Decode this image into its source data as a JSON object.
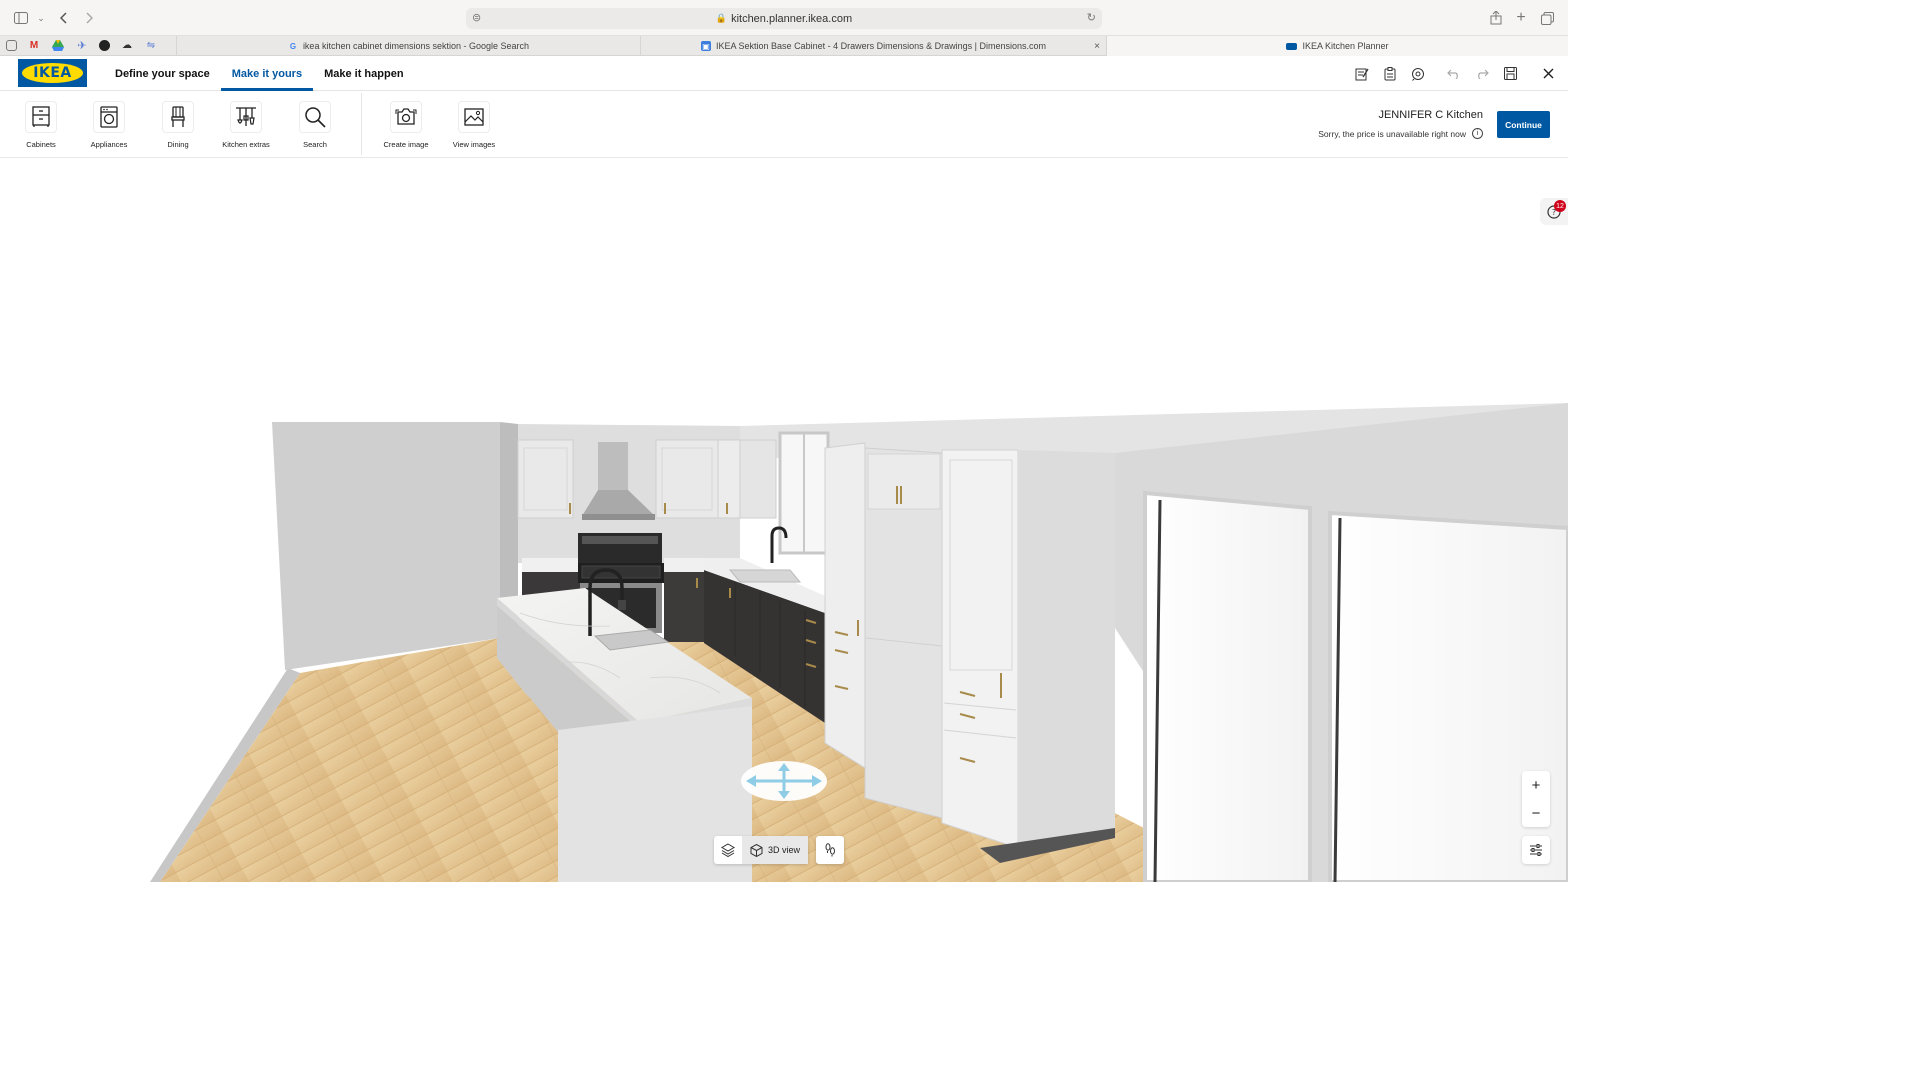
{
  "browser": {
    "url": "kitchen.planner.ikea.com",
    "tabs": [
      {
        "title": "ikea kitchen cabinet dimensions sektion - Google Search",
        "icon": "google-icon"
      },
      {
        "title": "IKEA Sektion Base Cabinet - 4 Drawers Dimensions & Drawings | Dimensions.com",
        "icon": "dimensions-icon"
      },
      {
        "title": "IKEA Kitchen Planner",
        "icon": "ikea-icon"
      }
    ],
    "tab_close": "×"
  },
  "app": {
    "logo_text": "IKEA",
    "nav": [
      {
        "label": "Define your space",
        "active": false
      },
      {
        "label": "Make it yours",
        "active": true
      },
      {
        "label": "Make it happen",
        "active": false
      }
    ]
  },
  "toolbar": {
    "tools": [
      {
        "label": "Cabinets",
        "icon": "cabinet-icon"
      },
      {
        "label": "Appliances",
        "icon": "appliance-icon"
      },
      {
        "label": "Dining",
        "icon": "chair-icon"
      },
      {
        "label": "Kitchen extras",
        "icon": "utensils-icon"
      },
      {
        "label": "Search",
        "icon": "search-icon"
      },
      {
        "label": "Create image",
        "icon": "camera-icon"
      },
      {
        "label": "View images",
        "icon": "image-icon"
      }
    ],
    "project_name": "JENNIFER C Kitchen",
    "price_note": "Sorry, the price is unavailable right now",
    "continue_label": "Continue"
  },
  "viewport": {
    "help_badge": "12",
    "view_mode_label": "3D view",
    "zoom_in": "+",
    "zoom_out": "−"
  },
  "colors": {
    "ikea_blue": "#0058a3",
    "ikea_yellow": "#ffdb00",
    "badge_red": "#d0021b"
  }
}
